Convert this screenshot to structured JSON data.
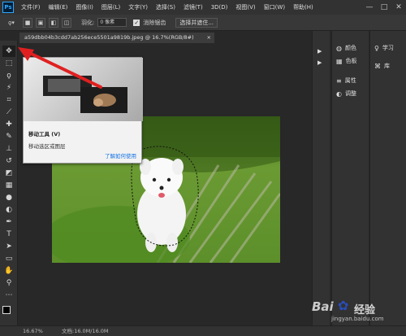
{
  "app": {
    "logo": "Ps"
  },
  "menubar": {
    "items": [
      "文件(F)",
      "编辑(E)",
      "图像(I)",
      "图层(L)",
      "文字(Y)",
      "选择(S)",
      "滤镜(T)",
      "3D(D)",
      "视图(V)",
      "窗口(W)",
      "帮助(H)"
    ],
    "minimize": "—",
    "maximize": "□",
    "close": "✕"
  },
  "options": {
    "feather_label": "羽化:",
    "feather_value": "0 像素",
    "antialias_label": "消除锯齿",
    "select_mask_label": "选择并遮住..."
  },
  "document": {
    "tab_title": "a59dbb04b3cdd7ab256ece5501a9819b.jpeg @ 16.7%(RGB/8#)",
    "close": "×"
  },
  "tooltip": {
    "title": "移动工具 (V)",
    "description": "移动选区或图层",
    "link": "了解如何使用"
  },
  "panels": {
    "col1": [
      "颜色",
      "色板",
      "属性",
      "调整"
    ],
    "col2": [
      "学习",
      "库"
    ]
  },
  "statusbar": {
    "zoom": "16.67%",
    "doc_info": "文档:16.0M/16.0M"
  },
  "watermark": {
    "brand": "Bai",
    "brand_suffix": "经验",
    "url": "jingyan.baidu.com"
  },
  "colors": {
    "accent": "#1473e6",
    "arrow": "#e02020",
    "bg": "#282828"
  },
  "icons": {
    "tools": [
      "move-icon",
      "marquee-icon",
      "lasso-icon",
      "magic-wand-icon",
      "crop-icon",
      "eyedropper-icon",
      "healing-brush-icon",
      "brush-icon",
      "clone-stamp-icon",
      "history-brush-icon",
      "eraser-icon",
      "gradient-icon",
      "blur-icon",
      "dodge-icon",
      "pen-icon",
      "type-icon",
      "path-selection-icon",
      "shape-icon",
      "hand-icon",
      "zoom-icon",
      "more-tools-icon"
    ]
  }
}
